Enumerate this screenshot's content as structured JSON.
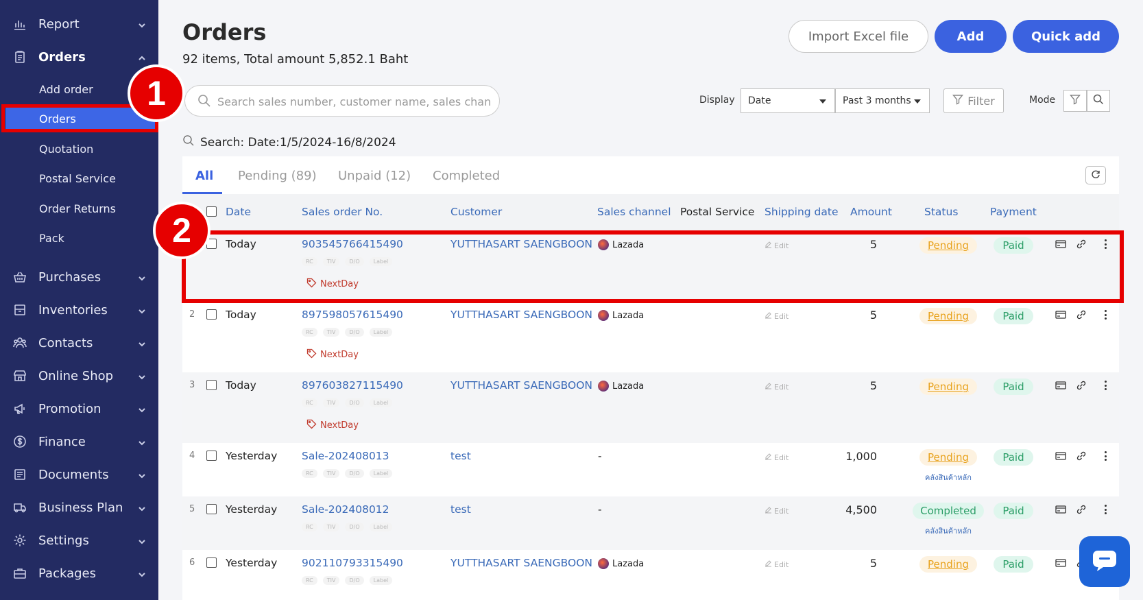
{
  "sidebar": {
    "items": [
      {
        "label": "Report"
      },
      {
        "label": "Orders"
      },
      {
        "label": "Purchases"
      },
      {
        "label": "Inventories"
      },
      {
        "label": "Contacts"
      },
      {
        "label": "Online Shop"
      },
      {
        "label": "Promotion"
      },
      {
        "label": "Finance"
      },
      {
        "label": "Documents"
      },
      {
        "label": "Business Plan"
      },
      {
        "label": "Settings"
      },
      {
        "label": "Packages"
      }
    ],
    "orders_sub": [
      {
        "label": "Add order"
      },
      {
        "label": "Orders"
      },
      {
        "label": "Quotation"
      },
      {
        "label": "Postal Service"
      },
      {
        "label": "Order Returns"
      },
      {
        "label": "Pack"
      }
    ]
  },
  "annotations": {
    "badge1": "1",
    "badge2": "2"
  },
  "header": {
    "title": "Orders",
    "summary": "92 items, Total amount 5,852.1 Baht",
    "import_label": "Import Excel file",
    "add_label": "Add",
    "quick_add_label": "Quick add"
  },
  "search": {
    "placeholder": "Search sales number, customer name, sales channel and",
    "info": "Search: Date:1/5/2024-16/8/2024"
  },
  "filters": {
    "display_label": "Display",
    "display_value": "Date",
    "range_value": "Past 3 months",
    "filter_label": "Filter",
    "mode_label": "Mode"
  },
  "tabs": [
    {
      "label": "All"
    },
    {
      "label": "Pending (89)"
    },
    {
      "label": "Unpaid (12)"
    },
    {
      "label": "Completed"
    }
  ],
  "columns": {
    "date": "Date",
    "sales_order_no": "Sales order No.",
    "customer": "Customer",
    "sales_channel": "Sales channel",
    "postal_service": "Postal Service",
    "shipping_date": "Shipping date",
    "amount": "Amount",
    "status": "Status",
    "payment": "Payment"
  },
  "mini_tags": [
    "RC",
    "TIV",
    "D/O",
    "Label"
  ],
  "edit_label": "Edit",
  "rows": [
    {
      "num": "",
      "date": "Today",
      "order_no": "903545766415490",
      "customer": "YUTTHASART SAENGBOON",
      "channel": "Lazada",
      "amount": "5",
      "status": "Pending",
      "payment": "Paid",
      "tag": "NextDay",
      "warehouse": ""
    },
    {
      "num": "2",
      "date": "Today",
      "order_no": "897598057615490",
      "customer": "YUTTHASART SAENGBOON",
      "channel": "Lazada",
      "amount": "5",
      "status": "Pending",
      "payment": "Paid",
      "tag": "NextDay",
      "warehouse": ""
    },
    {
      "num": "3",
      "date": "Today",
      "order_no": "897603827115490",
      "customer": "YUTTHASART SAENGBOON",
      "channel": "Lazada",
      "amount": "5",
      "status": "Pending",
      "payment": "Paid",
      "tag": "NextDay",
      "warehouse": ""
    },
    {
      "num": "4",
      "date": "Yesterday",
      "order_no": "Sale-202408013",
      "customer": "test",
      "channel": "-",
      "amount": "1,000",
      "status": "Pending",
      "payment": "Paid",
      "tag": "",
      "warehouse": "คลังสินค้าหลัก"
    },
    {
      "num": "5",
      "date": "Yesterday",
      "order_no": "Sale-202408012",
      "customer": "test",
      "channel": "-",
      "amount": "4,500",
      "status": "Completed",
      "payment": "Paid",
      "tag": "",
      "warehouse": "คลังสินค้าหลัก"
    },
    {
      "num": "6",
      "date": "Yesterday",
      "order_no": "902110793315490",
      "customer": "YUTTHASART SAENGBOON",
      "channel": "Lazada",
      "amount": "5",
      "status": "Pending",
      "payment": "Paid",
      "tag": "",
      "warehouse": ""
    }
  ],
  "colors": {
    "sidebar": "#232b62",
    "accent": "#3b62e0",
    "highlight": "#e60000"
  }
}
